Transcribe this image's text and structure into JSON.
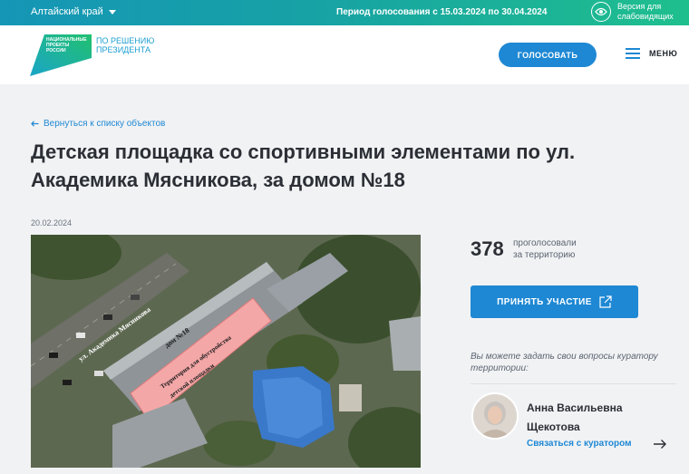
{
  "topbar": {
    "region": "Алтайский край",
    "period": "Период голосования с 15.03.2024 по 30.04.2024",
    "a11y_line1": "Версия для",
    "a11y_line2": "слабовидящих"
  },
  "header": {
    "logo_text": "НАЦИОНАЛЬНЫЕ ПРОЕКТЫ РОССИИ",
    "logo_sub_line1": "ПО РЕШЕНИЮ",
    "logo_sub_line2": "ПРЕЗИДЕНТА",
    "vote_label": "ГОЛОСОВАТЬ",
    "menu_label": "МЕНЮ"
  },
  "page": {
    "back_link": "Вернуться к списку объектов",
    "title": "Детская площадка со спортивными элементами по ул. Академика Мясникова, за домом №18",
    "date": "20.02.2024"
  },
  "photo": {
    "street_label": "ул. Академика Мясникова",
    "house_label": "дом №18",
    "area_label_line1": "Территория для обустройства",
    "area_label_line2": "детской площадки"
  },
  "sidebar": {
    "count": "378",
    "count_label_line1": "проголосовали",
    "count_label_line2": "за территорию",
    "join_label": "ПРИНЯТЬ УЧАСТИЕ",
    "hint": "Вы можете задать свои вопросы куратору территории:",
    "curator_name": "Анна Васильевна Щекотова",
    "contact_label": "Связаться с куратором"
  },
  "colors": {
    "accent": "#1e88d4",
    "topbar_start": "#1596b6",
    "topbar_end": "#1fbf8d",
    "highlight_area": "#f4a7a7"
  },
  "icons": {
    "region_caret": "chevron-down-icon",
    "a11y": "eye-icon",
    "menu": "hamburger-icon",
    "back": "arrow-left-icon",
    "join": "external-link-icon",
    "contact": "arrow-right-icon"
  }
}
